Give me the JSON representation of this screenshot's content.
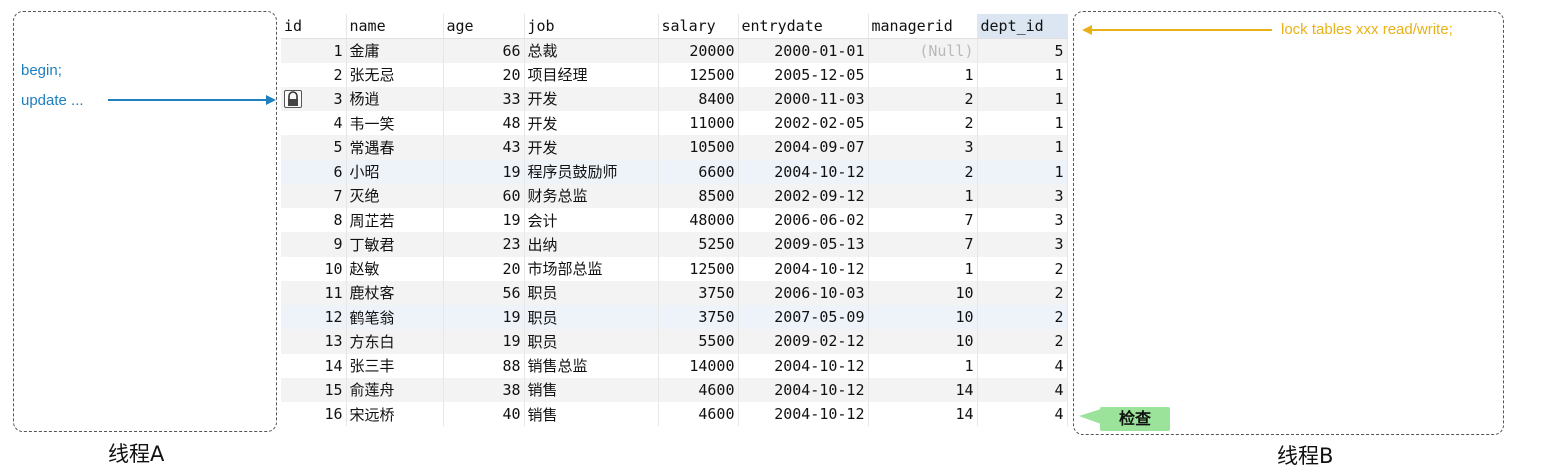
{
  "thread_a": {
    "label": "线程A",
    "lines": [
      "begin;",
      "update ..."
    ]
  },
  "thread_b": {
    "label": "线程B",
    "lock_command": "lock tables xxx read/write;",
    "check_label": "检查"
  },
  "colors": {
    "blue_note": "#1f7fbf",
    "yellow_note": "#e8b117",
    "callout_green": "#9be29b"
  },
  "table": {
    "columns": [
      "id",
      "name",
      "age",
      "job",
      "salary",
      "entrydate",
      "managerid",
      "dept_id"
    ],
    "locked_row_index": 2,
    "rows": [
      [
        "1",
        "金庸",
        "66",
        "总裁",
        "20000",
        "2000-01-01",
        "(Null)",
        "5"
      ],
      [
        "2",
        "张无忌",
        "20",
        "项目经理",
        "12500",
        "2005-12-05",
        "1",
        "1"
      ],
      [
        "3",
        "杨逍",
        "33",
        "开发",
        "8400",
        "2000-11-03",
        "2",
        "1"
      ],
      [
        "4",
        "韦一笑",
        "48",
        "开发",
        "11000",
        "2002-02-05",
        "2",
        "1"
      ],
      [
        "5",
        "常遇春",
        "43",
        "开发",
        "10500",
        "2004-09-07",
        "3",
        "1"
      ],
      [
        "6",
        "小昭",
        "19",
        "程序员鼓励师",
        "6600",
        "2004-10-12",
        "2",
        "1"
      ],
      [
        "7",
        "灭绝",
        "60",
        "财务总监",
        "8500",
        "2002-09-12",
        "1",
        "3"
      ],
      [
        "8",
        "周芷若",
        "19",
        "会计",
        "48000",
        "2006-06-02",
        "7",
        "3"
      ],
      [
        "9",
        "丁敏君",
        "23",
        "出纳",
        "5250",
        "2009-05-13",
        "7",
        "3"
      ],
      [
        "10",
        "赵敏",
        "20",
        "市场部总监",
        "12500",
        "2004-10-12",
        "1",
        "2"
      ],
      [
        "11",
        "鹿杖客",
        "56",
        "职员",
        "3750",
        "2006-10-03",
        "10",
        "2"
      ],
      [
        "12",
        "鹤笔翁",
        "19",
        "职员",
        "3750",
        "2007-05-09",
        "10",
        "2"
      ],
      [
        "13",
        "方东白",
        "19",
        "职员",
        "5500",
        "2009-02-12",
        "10",
        "2"
      ],
      [
        "14",
        "张三丰",
        "88",
        "销售总监",
        "14000",
        "2004-10-12",
        "1",
        "4"
      ],
      [
        "15",
        "俞莲舟",
        "38",
        "销售",
        "4600",
        "2004-10-12",
        "14",
        "4"
      ],
      [
        "16",
        "宋远桥",
        "40",
        "销售",
        "4600",
        "2004-10-12",
        "14",
        "4"
      ]
    ]
  }
}
